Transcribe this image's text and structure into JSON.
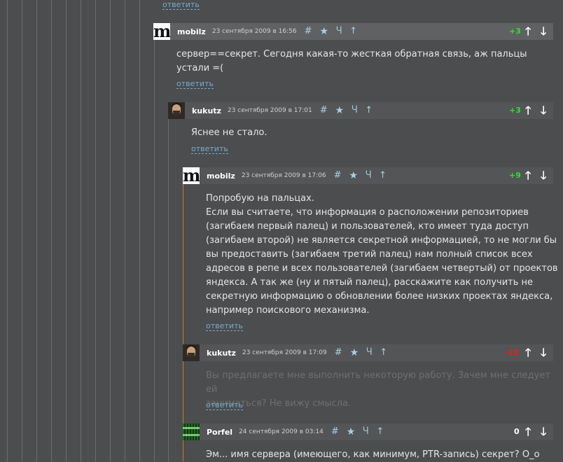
{
  "colors": {
    "background": "#4b4d4e",
    "header": "#535556",
    "link": "#7aaad0",
    "positive": "#2ee22e",
    "negative": "#e02020",
    "neutral": "#ffffff",
    "thread_accent": "#d07a2a"
  },
  "icons": {
    "anchor": "hash-icon",
    "favorite": "star-icon",
    "parent": "parent-link-icon",
    "up": "up-icon",
    "vote_up": "arrow-up-icon",
    "vote_down": "arrow-down-icon"
  },
  "top_reply": "ответить",
  "comments": [
    {
      "author": "mobilz",
      "date": "23 сентября 2009 в 16:56",
      "score": "+3",
      "score_type": "positive",
      "avatar": "m-logo-avatar",
      "body": [
        "сервер==секрет. Сегодня какая-то жесткая обратная связь, аж пальцы устали =(",
        ""
      ],
      "reply": "ответить"
    },
    {
      "author": "kukutz",
      "date": "23 сентября 2009 в 17:01",
      "score": "+3",
      "score_type": "positive",
      "avatar": "user-photo-avatar",
      "body": [
        "Яснее не стало."
      ],
      "reply": "ответить"
    },
    {
      "author": "mobilz",
      "date": "23 сентября 2009 в 17:06",
      "score": "+9",
      "score_type": "positive",
      "avatar": "m-logo-avatar",
      "body": [
        "Попробую на пальцах.",
        "Если вы считаете, что информация о расположении репозиториев",
        "(загибаем первый палец) и пользователей, кто имеет туда доступ",
        "(загибаем второй) не является секретной информацией, то не могли бы",
        "вы предоставить (загибаем третий палец) нам полный список всех",
        "адресов в репе и всех пользователей (загибаем четвертый) от проектов",
        "яндекса. А так же (ну и пятый палец), расскажите как получить не",
        "секретную информацию о обновлении более низких проектах яндекса,",
        "например поискового механизма."
      ],
      "reply": "ответить"
    },
    {
      "author": "kukutz",
      "date": "23 сентября 2009 в 17:09",
      "score": "-10",
      "score_type": "negative",
      "avatar": "user-photo-avatar",
      "body": [
        "Вы предлагаете мне выполнить некоторую работу. Зачем мне следует ей",
        "заниматься? Не вижу смысла."
      ],
      "reply": "ответить"
    },
    {
      "author": "Porfel",
      "date": "24 сентября 2009 в 03:14",
      "score": "0",
      "score_type": "neutral",
      "avatar": "matrix-avatar",
      "body": [
        "Эм... имя сервера (имеющего, как минимум, PTR-запись) секрет? O_o"
      ],
      "reply": ""
    }
  ]
}
